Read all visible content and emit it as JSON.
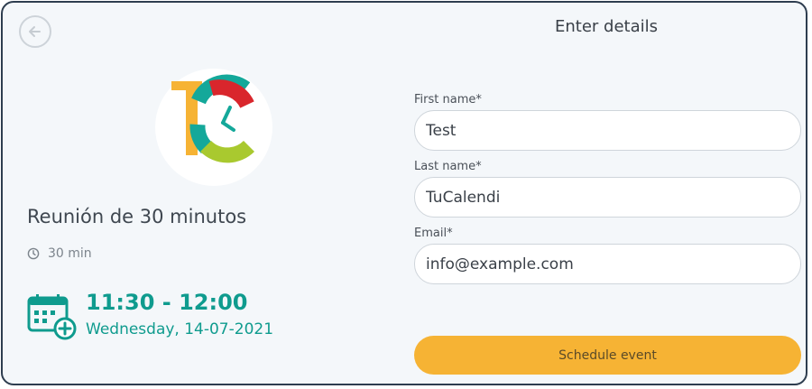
{
  "event": {
    "title": "Reunión de 30 minutos",
    "duration": "30 min",
    "time_range": "11:30 - 12:00",
    "date": "Wednesday, 14-07-2021"
  },
  "form": {
    "title": "Enter details",
    "first_name": {
      "label": "First name*",
      "value": "Test"
    },
    "last_name": {
      "label": "Last name*",
      "value": "TuCalendi"
    },
    "email": {
      "label": "Email*",
      "value": "info@example.com"
    },
    "submit_label": "Schedule event"
  },
  "icons": {
    "back": "arrow-left-circle-icon",
    "clock": "clock-icon",
    "calendar": "calendar-add-icon",
    "logo": "tucalendi-logo"
  },
  "colors": {
    "accent_teal": "#0f9b8e",
    "button_yellow": "#f6b334",
    "logo_orange": "#f6b334",
    "logo_red": "#d9262c",
    "logo_green": "#a9c92f",
    "logo_teal": "#14a89a"
  }
}
